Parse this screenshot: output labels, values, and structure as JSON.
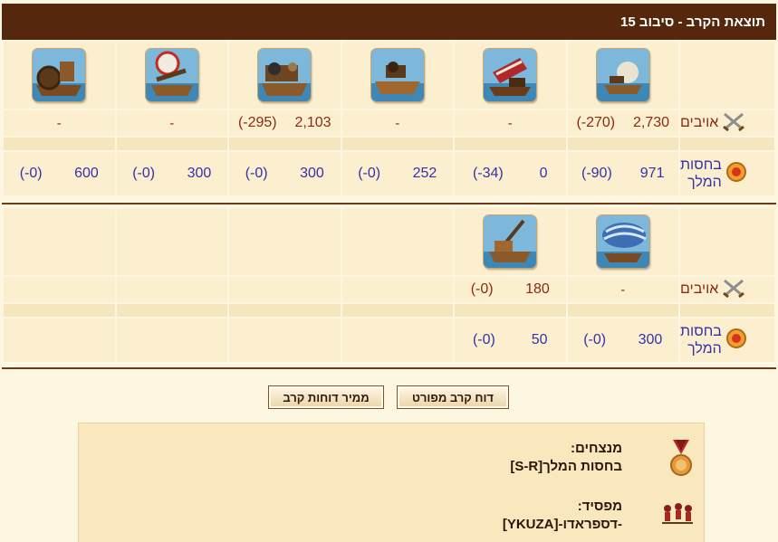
{
  "header": {
    "title": "תוצאת הקרב - סיבוב 15"
  },
  "labels": {
    "enemies": "אויבים",
    "royal_line1": "בחסות",
    "royal_line2": "המלך"
  },
  "round1": {
    "units": [
      {
        "icon": "fire-ship-icon",
        "enemy": [
          "2,730",
          "(-270)"
        ],
        "royal": [
          "971",
          "(-90)"
        ]
      },
      {
        "icon": "catapult-ship-icon",
        "enemy": [
          "-"
        ],
        "royal": [
          "0",
          "(-34)"
        ]
      },
      {
        "icon": "ram-ship-icon",
        "enemy": [
          "-"
        ],
        "royal": [
          "252",
          "(-0)"
        ]
      },
      {
        "icon": "mortar-ship-icon",
        "enemy": [
          "2,103",
          "(-295)"
        ],
        "royal": [
          "300",
          "(-0)"
        ]
      },
      {
        "icon": "ballista-ship-icon",
        "enemy": [
          "-"
        ],
        "royal": [
          "300",
          "(-0)"
        ]
      },
      {
        "icon": "paddle-ship-icon",
        "enemy": [
          "-"
        ],
        "royal": [
          "600",
          "(-0)"
        ]
      }
    ]
  },
  "round2": {
    "units": [
      {
        "icon": "balloon-carrier-icon",
        "enemy": [
          "-"
        ],
        "royal": [
          "300",
          "(-0)"
        ]
      },
      {
        "icon": "tender-ship-icon",
        "enemy": [
          "180",
          "(-0)"
        ],
        "royal": [
          "50",
          "(-0)"
        ]
      }
    ]
  },
  "buttons": {
    "detailed": "דוח קרב מפורט",
    "archive": "ממיר דוחות קרב"
  },
  "result": {
    "winners_label": "מנצחים:",
    "winners_value": "בחסות המלך[S-R]",
    "loser_label": "מפסיד:",
    "loser_value": "-דספראדו-[YKUZA]"
  },
  "colors": {
    "header_bg": "#55280d",
    "enemy_text": "#8b2a12",
    "royal_text": "#3531a8",
    "page_bg": "#fdf7e2"
  }
}
